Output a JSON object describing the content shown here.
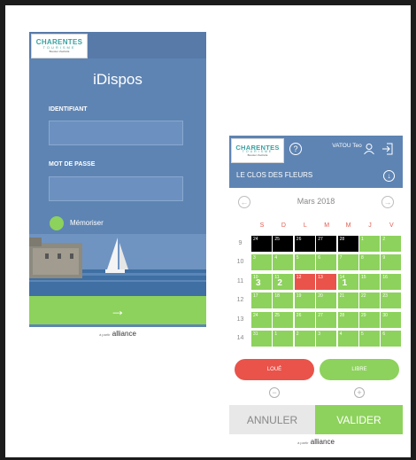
{
  "brand": {
    "line1": "CHARENTES",
    "line2": "TOURISME",
    "line3": "Booster d'activité",
    "footer_prefix": "à partir",
    "footer_name": "alliance"
  },
  "colors": {
    "primary_blue": "#5e84b3",
    "green": "#8dd25c",
    "red": "#e9534a",
    "black": "#000000"
  },
  "login": {
    "title": "iDispos",
    "identifier_label": "IDENTIFIANT",
    "identifier_value": "",
    "password_label": "MOT DE PASSE",
    "password_value": "",
    "remember_label": "Mémoriser",
    "submit_icon": "→"
  },
  "calendar": {
    "user_name": "VATOU Teo",
    "help_icon": "?",
    "lodging_name": "LE CLOS DES FLEURS",
    "expand_icon": "↓",
    "prev_icon": "←",
    "next_icon": "→",
    "month": "Mars 2018",
    "day_headers": [
      "S",
      "D",
      "L",
      "M",
      "M",
      "J",
      "V"
    ],
    "weeks": [
      "9",
      "10",
      "11",
      "12",
      "13",
      "14"
    ],
    "rows": [
      [
        {
          "d": "24",
          "s": "prev"
        },
        {
          "d": "25",
          "s": "prev"
        },
        {
          "d": "26",
          "s": "prev"
        },
        {
          "d": "27",
          "s": "prev"
        },
        {
          "d": "28",
          "s": "prev"
        },
        {
          "d": "1",
          "s": "free"
        },
        {
          "d": "2",
          "s": "free"
        }
      ],
      [
        {
          "d": "3",
          "s": "free"
        },
        {
          "d": "4",
          "s": "free"
        },
        {
          "d": "5",
          "s": "free"
        },
        {
          "d": "6",
          "s": "free"
        },
        {
          "d": "7",
          "s": "free"
        },
        {
          "d": "8",
          "s": "free"
        },
        {
          "d": "9",
          "s": "free"
        }
      ],
      [
        {
          "d": "10",
          "s": "free",
          "big": "3"
        },
        {
          "d": "11",
          "s": "free",
          "big": "2"
        },
        {
          "d": "12",
          "s": "booked"
        },
        {
          "d": "13",
          "s": "booked"
        },
        {
          "d": "14",
          "s": "free",
          "big": "1"
        },
        {
          "d": "15",
          "s": "free"
        },
        {
          "d": "16",
          "s": "free"
        }
      ],
      [
        {
          "d": "17",
          "s": "free"
        },
        {
          "d": "18",
          "s": "free"
        },
        {
          "d": "19",
          "s": "free"
        },
        {
          "d": "20",
          "s": "free"
        },
        {
          "d": "21",
          "s": "free"
        },
        {
          "d": "22",
          "s": "free"
        },
        {
          "d": "23",
          "s": "free"
        }
      ],
      [
        {
          "d": "24",
          "s": "free"
        },
        {
          "d": "25",
          "s": "free"
        },
        {
          "d": "26",
          "s": "free"
        },
        {
          "d": "27",
          "s": "free"
        },
        {
          "d": "28",
          "s": "free"
        },
        {
          "d": "29",
          "s": "free"
        },
        {
          "d": "30",
          "s": "free"
        }
      ],
      [
        {
          "d": "31",
          "s": "free"
        },
        {
          "d": "1",
          "s": "free"
        },
        {
          "d": "2",
          "s": "free"
        },
        {
          "d": "3",
          "s": "free"
        },
        {
          "d": "4",
          "s": "free"
        },
        {
          "d": "5",
          "s": "free"
        },
        {
          "d": "6",
          "s": "free"
        }
      ]
    ],
    "legend_booked": "LOUÉ",
    "legend_free": "LIBRE",
    "minus_icon": "−",
    "plus_icon": "+",
    "cancel_label": "ANNULER",
    "validate_label": "VALIDER"
  }
}
